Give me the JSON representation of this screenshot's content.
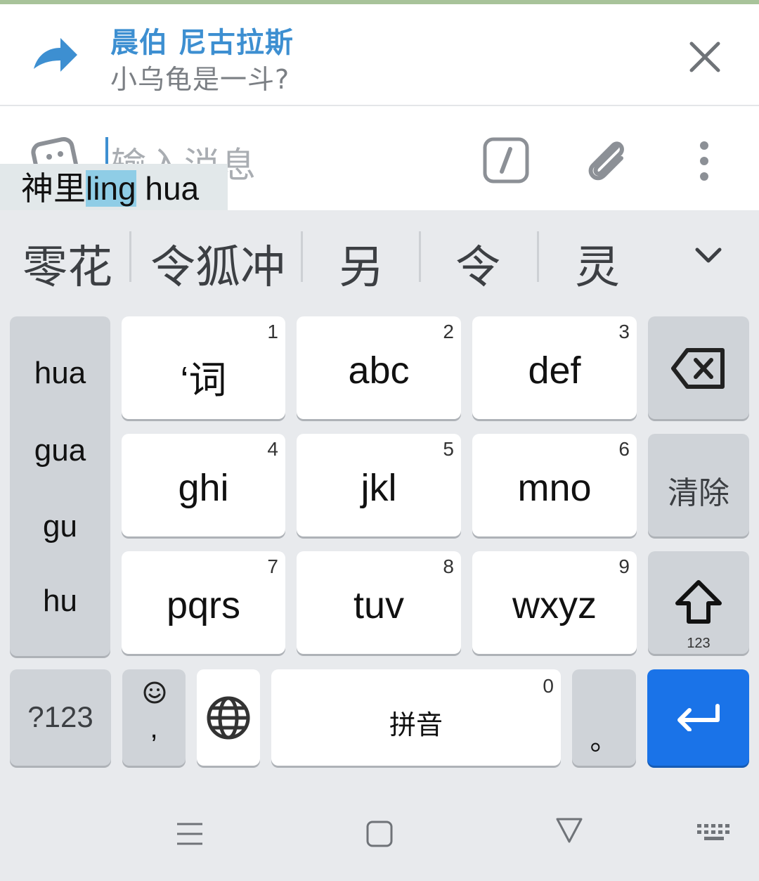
{
  "reply_bar": {
    "name": "晨伯 尼古拉斯",
    "message": "小乌龟是一斗?"
  },
  "input_bar": {
    "placeholder": "输入消息"
  },
  "composing": {
    "prefix": "神里",
    "highlight": "ling",
    "suffix": " hua"
  },
  "candidates": [
    "零花",
    "令狐冲",
    "另",
    "令",
    "灵"
  ],
  "pinyin_options": [
    "hua",
    "gua",
    "gu",
    "hu"
  ],
  "keys": {
    "k1": {
      "label": "‘词",
      "num": "1"
    },
    "k2": {
      "label": "abc",
      "num": "2"
    },
    "k3": {
      "label": "def",
      "num": "3"
    },
    "k4": {
      "label": "ghi",
      "num": "4"
    },
    "k5": {
      "label": "jkl",
      "num": "5"
    },
    "k6": {
      "label": "mno",
      "num": "6"
    },
    "k7": {
      "label": "pqrs",
      "num": "7"
    },
    "k8": {
      "label": "tuv",
      "num": "8"
    },
    "k9": {
      "label": "wxyz",
      "num": "9"
    },
    "clear": "清除",
    "shift_sub": "123",
    "symbols": "?123",
    "comma": ",",
    "space": "拼音",
    "space_num": "0",
    "period": "。"
  },
  "colors": {
    "accent": "#3d8fd1",
    "enter_key": "#1a73e8",
    "composing_highlight": "#8fcde6"
  }
}
